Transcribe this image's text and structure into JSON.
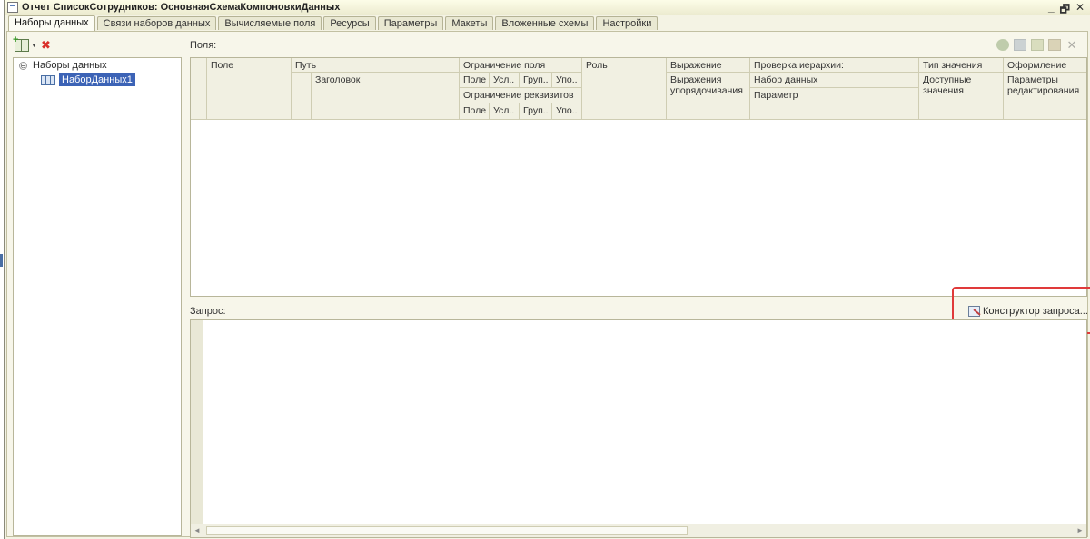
{
  "window": {
    "title": "Отчет СписокСотрудников: ОсновнаяСхемаКомпоновкиДанных",
    "controls": [
      "_",
      "🗗",
      "✕"
    ]
  },
  "tabs": [
    {
      "label": "Наборы данных",
      "active": true
    },
    {
      "label": "Связи наборов данных"
    },
    {
      "label": "Вычисляемые поля"
    },
    {
      "label": "Ресурсы"
    },
    {
      "label": "Параметры"
    },
    {
      "label": "Макеты"
    },
    {
      "label": "Вложенные схемы"
    },
    {
      "label": "Настройки"
    }
  ],
  "tree": {
    "root": "Наборы данных",
    "toggle": "⊖",
    "child": "НаборДанных1"
  },
  "fields": {
    "label": "Поля:",
    "headers": {
      "pole": "Поле",
      "put": "Путь",
      "zagolovok": "Заголовок",
      "ogr_polya": "Ограничение поля",
      "ogr_rekv": "Ограничение реквизитов",
      "sub_pole": "Поле",
      "sub_usl": "Усл..",
      "sub_grup": "Груп..",
      "sub_upo": "Упо..",
      "sub_pole2": "Поле",
      "sub_usl2": "Усл..",
      "sub_grup2": "Груп..",
      "sub_upo2": "Упо..",
      "rol": "Роль",
      "vyr_pred": "Выражение пред..",
      "vyr_upor": "Выражения упорядочивания",
      "prov_ier": "Проверка иерархии:",
      "nabor": "Набор данных",
      "parametr": "Параметр",
      "tip": "Тип значения",
      "dostup": "Доступные значения",
      "oform": "Оформление",
      "param_red": "Параметры редактирования"
    }
  },
  "query": {
    "label": "Запрос:",
    "constructor_button": "Конструктор запроса..."
  }
}
